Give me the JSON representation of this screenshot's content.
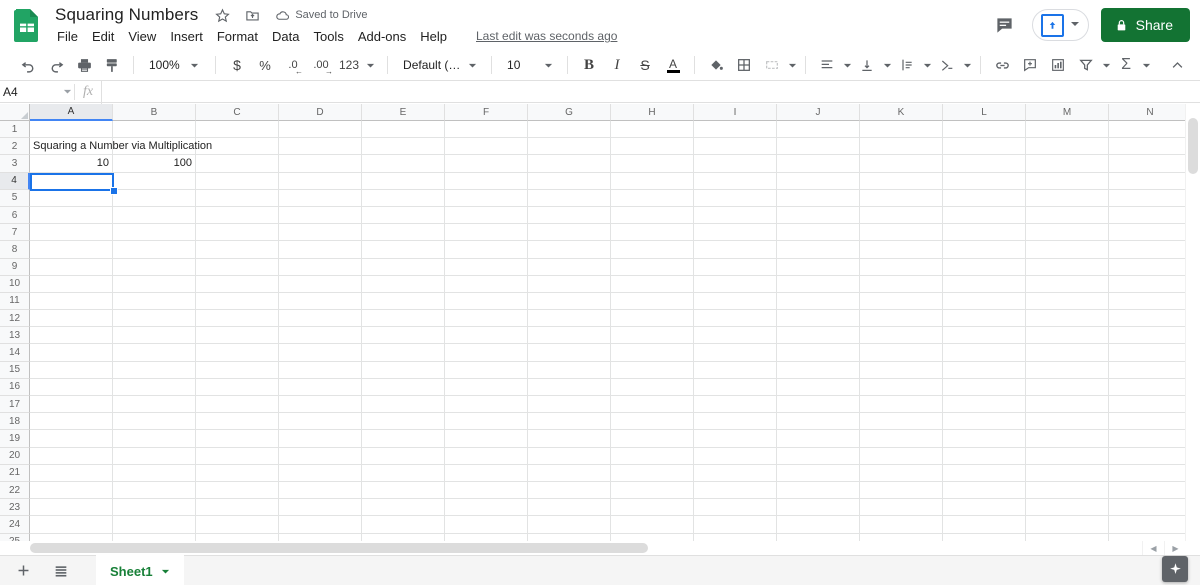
{
  "app": {
    "name": "Google Sheets",
    "logo_icon": "sheets-logo-icon"
  },
  "header": {
    "doc_title": "Squaring Numbers",
    "star_icon": "star-icon",
    "move_icon": "move-to-folder-icon",
    "cloud_icon": "cloud-icon",
    "save_state": "Saved to Drive",
    "menus": [
      {
        "label": "File",
        "name": "menu-file"
      },
      {
        "label": "Edit",
        "name": "menu-edit"
      },
      {
        "label": "View",
        "name": "menu-view"
      },
      {
        "label": "Insert",
        "name": "menu-insert"
      },
      {
        "label": "Format",
        "name": "menu-format"
      },
      {
        "label": "Data",
        "name": "menu-data"
      },
      {
        "label": "Tools",
        "name": "menu-tools"
      },
      {
        "label": "Add-ons",
        "name": "menu-add-ons"
      },
      {
        "label": "Help",
        "name": "menu-help"
      }
    ],
    "last_edit": "Last edit was seconds ago",
    "comment_icon": "comment-icon",
    "present_icon": "present-icon",
    "present_caret_icon": "chevron-down-icon",
    "share_lock_icon": "lock-icon",
    "share_label": "Share",
    "share_color": "#137333"
  },
  "toolbar": {
    "undo_icon": "undo-icon",
    "redo_icon": "redo-icon",
    "print_icon": "print-icon",
    "paint_format_icon": "paint-format-icon",
    "zoom_value": "100%",
    "currency_label": "$",
    "percent_label": "%",
    "decrease_decimal_label": ".0",
    "increase_decimal_label": ".00",
    "more_formats_label": "123",
    "font_value": "Default (Ari...",
    "font_size_value": "10",
    "bold_label": "B",
    "italic_label": "I",
    "strikethrough_label": "S",
    "text_color_label": "A",
    "fill_color_icon": "fill-color-icon",
    "borders_icon": "borders-icon",
    "merge_cells_icon": "merge-cells-icon",
    "horizontal_align_icon": "horizontal-align-icon",
    "vertical_align_icon": "vertical-align-icon",
    "text_wrap_icon": "text-wrapping-icon",
    "text_rotation_icon": "text-rotation-icon",
    "insert_link_icon": "insert-link-icon",
    "insert_comment_icon": "insert-comment-icon",
    "insert_chart_icon": "insert-chart-icon",
    "filter_icon": "filter-icon",
    "functions_label": "Σ",
    "collapse_icon": "chevron-up-icon"
  },
  "formula_bar": {
    "name_box_value": "A4",
    "name_box_arrow_icon": "chevron-down-icon",
    "fx_label": "fx",
    "formula_value": "",
    "formula_placeholder": ""
  },
  "grid": {
    "columns": [
      "A",
      "B",
      "C",
      "D",
      "E",
      "F",
      "G",
      "H",
      "I",
      "J",
      "K",
      "L",
      "M",
      "N"
    ],
    "selected_column": "A",
    "rows": [
      1,
      2,
      3,
      4,
      5,
      6,
      7,
      8,
      9,
      10,
      11,
      12,
      13,
      14,
      15,
      16,
      17,
      18,
      19,
      20,
      21,
      22,
      23,
      24,
      25
    ],
    "selected_row": 4,
    "selected_cell": "A4",
    "selection_color": "#1a73e8",
    "cells": [
      {
        "ref": "A2",
        "row": 2,
        "col": 0,
        "value": "Squaring a Number via Multiplication",
        "align": "left",
        "overflow": true
      },
      {
        "ref": "A3",
        "row": 3,
        "col": 0,
        "value": "10",
        "align": "right",
        "overflow": false
      },
      {
        "ref": "B3",
        "row": 3,
        "col": 1,
        "value": "100",
        "align": "right",
        "overflow": false
      }
    ]
  },
  "bottom": {
    "add_sheet_icon": "add-sheet-icon",
    "all_sheets_icon": "all-sheets-icon",
    "sheet_tabs": [
      {
        "label": "Sheet1",
        "active": true,
        "arrow_icon": "chevron-down-icon"
      }
    ],
    "explore_icon": "explore-icon"
  },
  "scrollbars": {
    "h_left_arrow_icon": "left-arrow-icon",
    "h_right_arrow_icon": "right-arrow-icon"
  }
}
